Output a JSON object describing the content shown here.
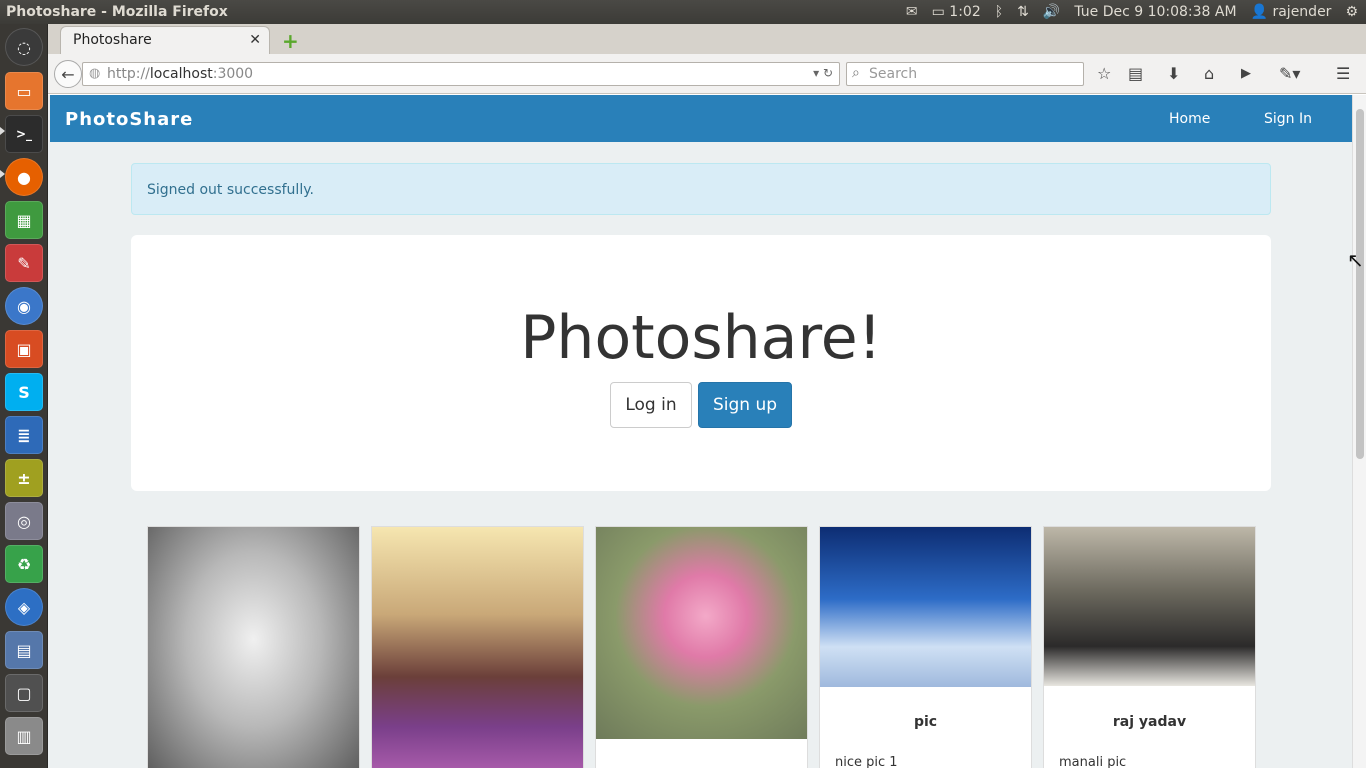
{
  "system": {
    "window_title": "Photoshare - Mozilla Firefox",
    "battery": "1:02",
    "clock": "Tue Dec  9 10:08:38 AM",
    "user": "rajender"
  },
  "browser": {
    "tab_title": "Photoshare",
    "url_prefix": "http://",
    "url_host": "localhost",
    "url_port": ":3000",
    "search_placeholder": "Search"
  },
  "site": {
    "brand": "PhotoShare",
    "nav": {
      "home": "Home",
      "sign_in": "Sign In"
    },
    "alert": "Signed out successfully.",
    "hero": {
      "title": "Photoshare!",
      "login": "Log in",
      "signup": "Sign up"
    },
    "photos": [
      {
        "title": "",
        "desc": "",
        "colors": [
          "#e8e8e8",
          "#6a6a6a"
        ]
      },
      {
        "title": "",
        "desc": "",
        "colors": [
          "#f4d27a",
          "#7a3a6a"
        ]
      },
      {
        "title": "",
        "desc": "",
        "colors": [
          "#9aa77f",
          "#e889b0"
        ]
      },
      {
        "title": "pic",
        "desc": "nice pic 1",
        "colors": [
          "#1e4fa8",
          "#dfe9f6"
        ]
      },
      {
        "title": "raj  yadav",
        "desc": "manali pic",
        "colors": [
          "#6d6a5f",
          "#2b2a2a"
        ]
      }
    ]
  },
  "colors": {
    "brand_blue": "#2980b9",
    "page_bg": "#ecf0f1",
    "alert_bg": "#d9edf7"
  }
}
